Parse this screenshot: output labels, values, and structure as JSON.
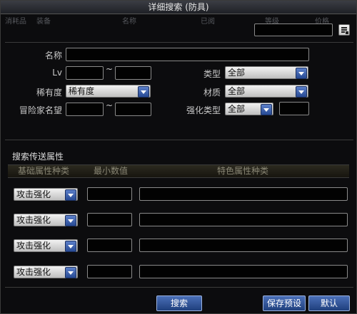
{
  "window": {
    "title": "详细搜索 (防具)"
  },
  "background_header": [
    "消耗品",
    "装备",
    "名称",
    "已阅",
    "等级",
    "价格"
  ],
  "filter_icon": "filter-list-icon",
  "labels": {
    "name": "名称",
    "lv": "Lv",
    "rarity": "稀有度",
    "adventurer": "冒险家名望",
    "type": "类型",
    "material": "材质",
    "enhance_type": "强化类型",
    "tilde": "~"
  },
  "selects": {
    "rarity": "稀有度",
    "type": "全部",
    "material": "全部",
    "enhance_type": "全部"
  },
  "section_title": "搜索传送属性",
  "columns": [
    "基础属性种类",
    "最小数值",
    "特色属性种类"
  ],
  "attribute_rows": [
    {
      "type": "攻击强化"
    },
    {
      "type": "攻击强化"
    },
    {
      "type": "攻击强化"
    },
    {
      "type": "攻击强化"
    }
  ],
  "buttons": {
    "search": "搜索",
    "save_preset": "保存预设",
    "default": "默认"
  },
  "colors": {
    "accent": "#2f54a0",
    "panel_bg": "#0c0c0e"
  }
}
